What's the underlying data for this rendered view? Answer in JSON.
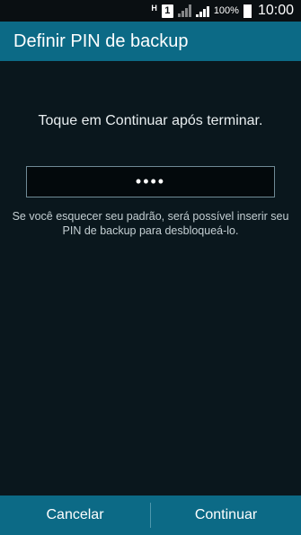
{
  "status_bar": {
    "network_indicator": "H",
    "sim_slot": "1",
    "battery_percent": "100%",
    "time": "10:00"
  },
  "action_bar": {
    "title": "Definir PIN de backup"
  },
  "main": {
    "instruction": "Toque em Continuar após terminar.",
    "pin_value": "••••",
    "hint_line1": "Se você esquecer seu padrão, será possível inserir seu",
    "hint_line2": "PIN de backup para desbloqueá-lo."
  },
  "bottom_bar": {
    "cancel_label": "Cancelar",
    "continue_label": "Continuar"
  },
  "colors": {
    "accent": "#0c6a86",
    "background": "#0a171d"
  },
  "icons": [
    "sim-icon",
    "signal-icon",
    "battery-icon"
  ]
}
